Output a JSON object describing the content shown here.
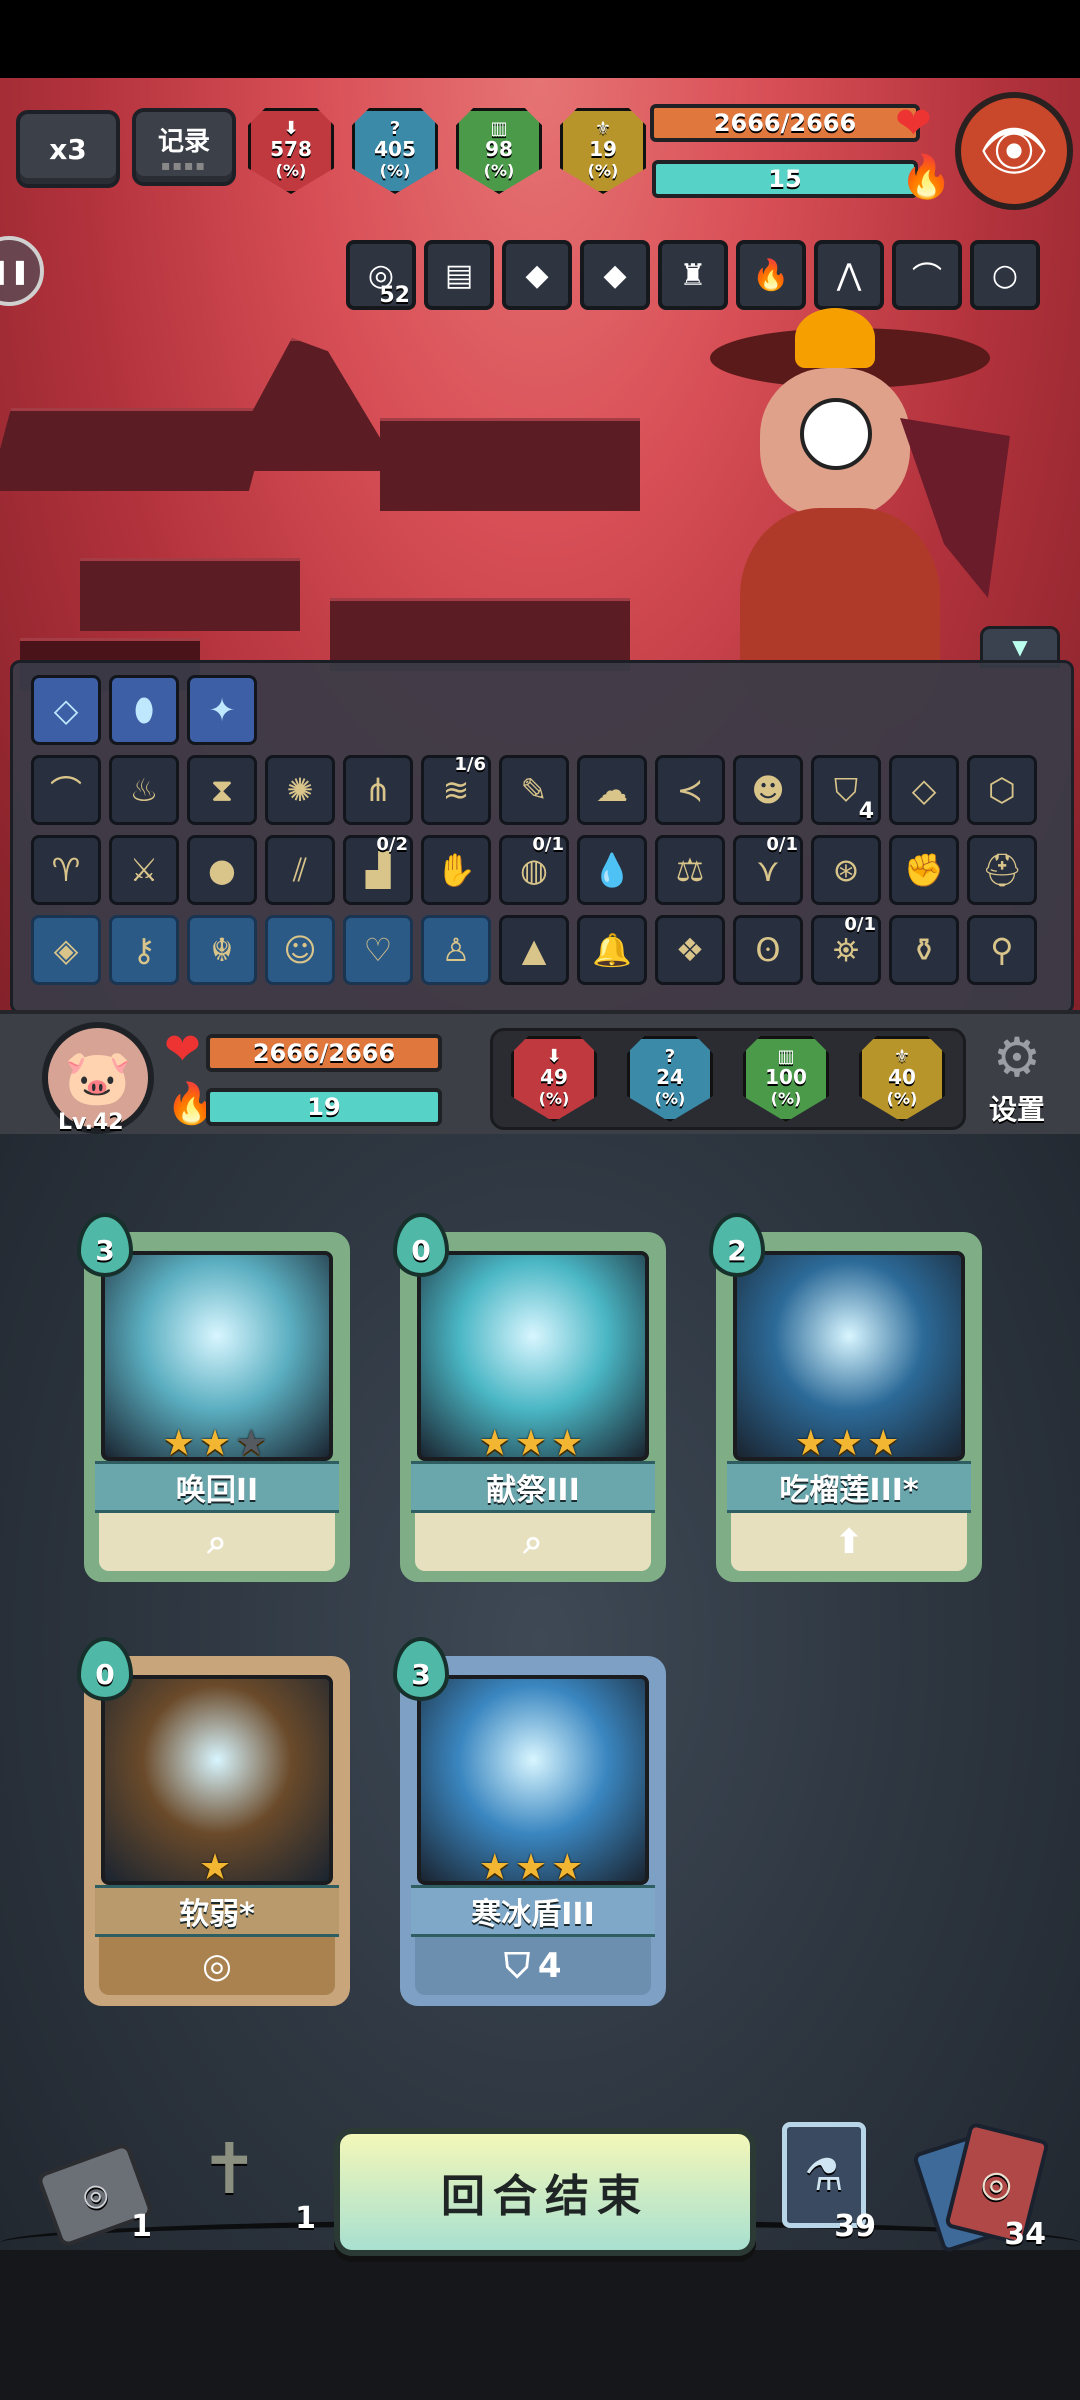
{
  "hud": {
    "speed_label": "x3",
    "record_label": "记录",
    "enemy_stats": [
      {
        "value": "578",
        "unit": "(%)",
        "color": "#c0393e",
        "icon": "attack-icon"
      },
      {
        "value": "405",
        "unit": "(%)",
        "color": "#3a8aa8",
        "icon": "mystery-icon"
      },
      {
        "value": "98",
        "unit": "(%)",
        "color": "#4a9a4a",
        "icon": "defense-icon"
      },
      {
        "value": "19",
        "unit": "(%)",
        "color": "#b8952a",
        "icon": "luck-icon"
      }
    ]
  },
  "enemy": {
    "hp_text": "2666/2666",
    "energy_text": "15",
    "relics": [
      {
        "icon": "spiral-icon",
        "count": "52"
      },
      {
        "icon": "book-icon",
        "count": ""
      },
      {
        "icon": "green-stone-icon",
        "count": ""
      },
      {
        "icon": "green-stone-icon",
        "count": ""
      },
      {
        "icon": "wizard-icon",
        "count": ""
      },
      {
        "icon": "flame-icon",
        "count": ""
      },
      {
        "icon": "claw-icon",
        "count": ""
      },
      {
        "icon": "horn-icon",
        "count": ""
      },
      {
        "icon": "bead-necklace-icon",
        "count": ""
      }
    ]
  },
  "inventory": {
    "gems": [
      {
        "icon": "crystal-icon"
      },
      {
        "icon": "green-egg-icon"
      },
      {
        "icon": "sapphire-icon"
      }
    ],
    "rows": [
      [
        {
          "icon": "horn-icon",
          "frac": "",
          "num": ""
        },
        {
          "icon": "torch-icon",
          "frac": "",
          "num": ""
        },
        {
          "icon": "hourglass-icon",
          "frac": "",
          "num": ""
        },
        {
          "icon": "medallion-icon",
          "frac": "",
          "num": ""
        },
        {
          "icon": "trap-icon",
          "frac": "",
          "num": ""
        },
        {
          "icon": "scroll-icon",
          "frac": "1/6",
          "num": ""
        },
        {
          "icon": "brush-icon",
          "frac": "",
          "num": ""
        },
        {
          "icon": "ghost-icon",
          "frac": "",
          "num": ""
        },
        {
          "icon": "fish-icon",
          "frac": "",
          "num": ""
        },
        {
          "icon": "mask-icon",
          "frac": "",
          "num": ""
        },
        {
          "icon": "shield-icon",
          "frac": "",
          "num": "4"
        },
        {
          "icon": "crystal-icon",
          "frac": "",
          "num": ""
        },
        {
          "icon": "rune-stone-icon",
          "frac": "",
          "num": ""
        }
      ],
      [
        {
          "icon": "bird-icon",
          "frac": "",
          "num": ""
        },
        {
          "icon": "sword-icon",
          "frac": "",
          "num": ""
        },
        {
          "icon": "pouch-icon",
          "frac": "",
          "num": ""
        },
        {
          "icon": "twin-blade-icon",
          "frac": "",
          "num": ""
        },
        {
          "icon": "boots-icon",
          "frac": "0/2",
          "num": ""
        },
        {
          "icon": "glove-icon",
          "frac": "",
          "num": ""
        },
        {
          "icon": "galaxy-icon",
          "frac": "0/1",
          "num": ""
        },
        {
          "icon": "water-drop-icon",
          "frac": "",
          "num": ""
        },
        {
          "icon": "scales-icon",
          "frac": "",
          "num": ""
        },
        {
          "icon": "fang-icon",
          "frac": "0/1",
          "num": ""
        },
        {
          "icon": "swirl-icon",
          "frac": "",
          "num": ""
        },
        {
          "icon": "gauntlet-icon",
          "frac": "",
          "num": ""
        },
        {
          "icon": "helmet-icon",
          "frac": "",
          "num": ""
        }
      ],
      [
        {
          "icon": "diamond-rune-icon",
          "frac": "",
          "num": ""
        },
        {
          "icon": "key-rune-icon",
          "frac": "",
          "num": ""
        },
        {
          "icon": "dragon-rune-icon",
          "frac": "",
          "num": ""
        },
        {
          "icon": "face-rune-icon",
          "frac": "",
          "num": ""
        },
        {
          "icon": "heart-rune-icon",
          "frac": "",
          "num": ""
        },
        {
          "icon": "figure-rune-icon",
          "frac": "",
          "num": ""
        },
        {
          "icon": "ore-icon",
          "frac": "",
          "num": ""
        },
        {
          "icon": "bell-icon",
          "frac": "",
          "num": ""
        },
        {
          "icon": "ice-block-icon",
          "frac": "",
          "num": ""
        },
        {
          "icon": "owl-icon",
          "frac": "",
          "num": ""
        },
        {
          "icon": "lantern-icon",
          "frac": "0/1",
          "num": ""
        },
        {
          "icon": "potion-sack-icon",
          "frac": "",
          "num": ""
        },
        {
          "icon": "whisk-icon",
          "frac": "",
          "num": ""
        }
      ]
    ]
  },
  "player": {
    "level": "Lv.42",
    "hp_text": "2666/2666",
    "energy_text": "19",
    "stats": [
      {
        "value": "49",
        "unit": "(%)",
        "color": "#c0393e",
        "icon": "attack-icon"
      },
      {
        "value": "24",
        "unit": "(%)",
        "color": "#3a8aa8",
        "icon": "mystery-icon"
      },
      {
        "value": "100",
        "unit": "(%)",
        "color": "#4a9a4a",
        "icon": "defense-icon"
      },
      {
        "value": "40",
        "unit": "(%)",
        "color": "#b8952a",
        "icon": "luck-icon"
      }
    ],
    "settings_label": "设置"
  },
  "hand": [
    {
      "cost": "3",
      "name": "唤回II",
      "stars": 2,
      "max_stars": 3,
      "foot_icon": "whistle-icon",
      "foot_value": "",
      "theme": "teal",
      "art": "#5aaec0"
    },
    {
      "cost": "0",
      "name": "献祭III",
      "stars": 3,
      "max_stars": 3,
      "foot_icon": "whistle-icon",
      "foot_value": "",
      "theme": "teal",
      "art": "#4ab6c4"
    },
    {
      "cost": "2",
      "name": "吃榴莲III*",
      "stars": 3,
      "max_stars": 3,
      "foot_icon": "up-arrow-icon",
      "foot_value": "",
      "theme": "teal",
      "art": "#2c6a98"
    },
    {
      "cost": "0",
      "name": "软弱*",
      "stars": 1,
      "max_stars": 1,
      "foot_icon": "spiral-icon",
      "foot_value": "",
      "theme": "brown",
      "art": "#6a4a2a"
    },
    {
      "cost": "3",
      "name": "寒冰盾III",
      "stars": 3,
      "max_stars": 3,
      "foot_icon": "shield-icon",
      "foot_value": "4",
      "theme": "blue",
      "art": "#3a86c0"
    }
  ],
  "bottom": {
    "end_turn_label": "回合结束",
    "deck_count": "1",
    "grave_count": "1",
    "potion_count": "39",
    "discard_count": "34"
  }
}
